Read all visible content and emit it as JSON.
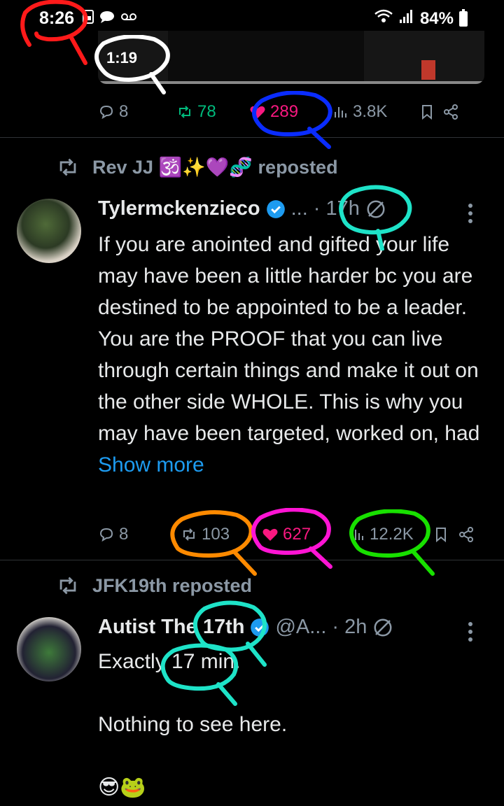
{
  "status_bar": {
    "time": "8:26",
    "battery": "84%",
    "left_icons": [
      "photo-icon",
      "chat-icon",
      "voicemail-icon"
    ],
    "right_icons": [
      "wifi-icon",
      "signal-icon",
      "battery-icon"
    ]
  },
  "video": {
    "duration": "1:19"
  },
  "tweet0": {
    "replies": "8",
    "reposts": "78",
    "likes": "289",
    "views": "3.8K",
    "reposted": true,
    "liked": true
  },
  "tweet1": {
    "repost_header": "Rev JJ 🕉️✨💜🧬 reposted",
    "name": "Tylermckenzieco",
    "handle": "...",
    "time": "· 17h",
    "text": "If you are anointed and gifted your life may have been a little harder bc you are destined to be appointed to be a leader. You are the PROOF that you can live through certain things and make it out on the other side WHOLE.  This is why you may have been targeted, worked on, had ",
    "show_more": "Show more",
    "replies": "8",
    "reposts": "103",
    "likes": "627",
    "views": "12.2K",
    "liked": true
  },
  "tweet2": {
    "repost_header": "JFK19th reposted",
    "name": "Autist The 17th",
    "handle": "@A...",
    "time": "· 2h",
    "line1": "Exactly 17 min.",
    "line2": "Nothing to see here.",
    "line3": "😎🐸"
  },
  "colors": {
    "background": "#000000",
    "text": "#e7e9ea",
    "muted": "#8b98a5",
    "like": "#f91880",
    "repost": "#00ba7c",
    "link": "#1d9bf0",
    "verified": "#1d9bf0"
  }
}
